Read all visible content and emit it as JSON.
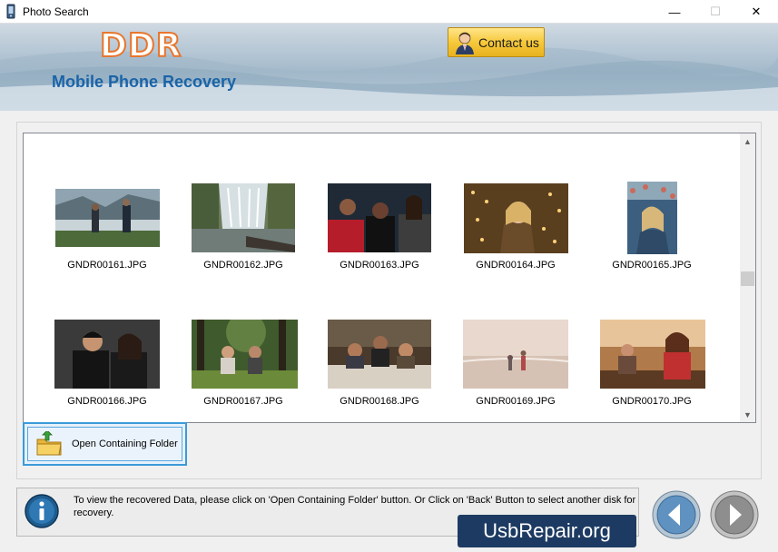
{
  "window": {
    "title": "Photo Search",
    "minimize_glyph": "—",
    "maximize_glyph": "☐",
    "close_glyph": "✕"
  },
  "banner": {
    "logo": "DDR",
    "product": "Mobile Phone Recovery",
    "contact_label": "Contact us"
  },
  "gallery": {
    "items": [
      {
        "filename": "GNDR00161.JPG",
        "scene": "two-people-lake-mountain"
      },
      {
        "filename": "GNDR00162.JPG",
        "scene": "waterfall-people"
      },
      {
        "filename": "GNDR00163.JPG",
        "scene": "group-portrait-dark"
      },
      {
        "filename": "GNDR00164.JPG",
        "scene": "girl-lights"
      },
      {
        "filename": "GNDR00165.JPG",
        "scene": "woman-crowd"
      },
      {
        "filename": "GNDR00166.JPG",
        "scene": "couple-dark"
      },
      {
        "filename": "GNDR00167.JPG",
        "scene": "friends-forest"
      },
      {
        "filename": "GNDR00168.JPG",
        "scene": "dinner-party"
      },
      {
        "filename": "GNDR00169.JPG",
        "scene": "kids-beach"
      },
      {
        "filename": "GNDR00170.JPG",
        "scene": "friends-sunset"
      }
    ],
    "scroll_up_glyph": "▲",
    "scroll_down_glyph": "▼"
  },
  "actions": {
    "open_folder_label": "Open Containing Folder"
  },
  "info": {
    "message": "To view the recovered Data, please click on 'Open Containing Folder' button. Or Click on 'Back' Button to select another disk for recovery."
  },
  "watermark": "UsbRepair.org",
  "icons": {
    "app": "phone-icon",
    "contact": "person-icon",
    "folder": "folder-icon",
    "info": "info-icon",
    "back": "back-arrow-icon",
    "next": "next-arrow-icon"
  },
  "colors": {
    "accent_blue": "#1a64a8",
    "logo_orange": "#e8762c",
    "contact_gold": "#f6c93b",
    "focus_border": "#3c9ad8",
    "watermark_bg": "#1d3b62"
  }
}
